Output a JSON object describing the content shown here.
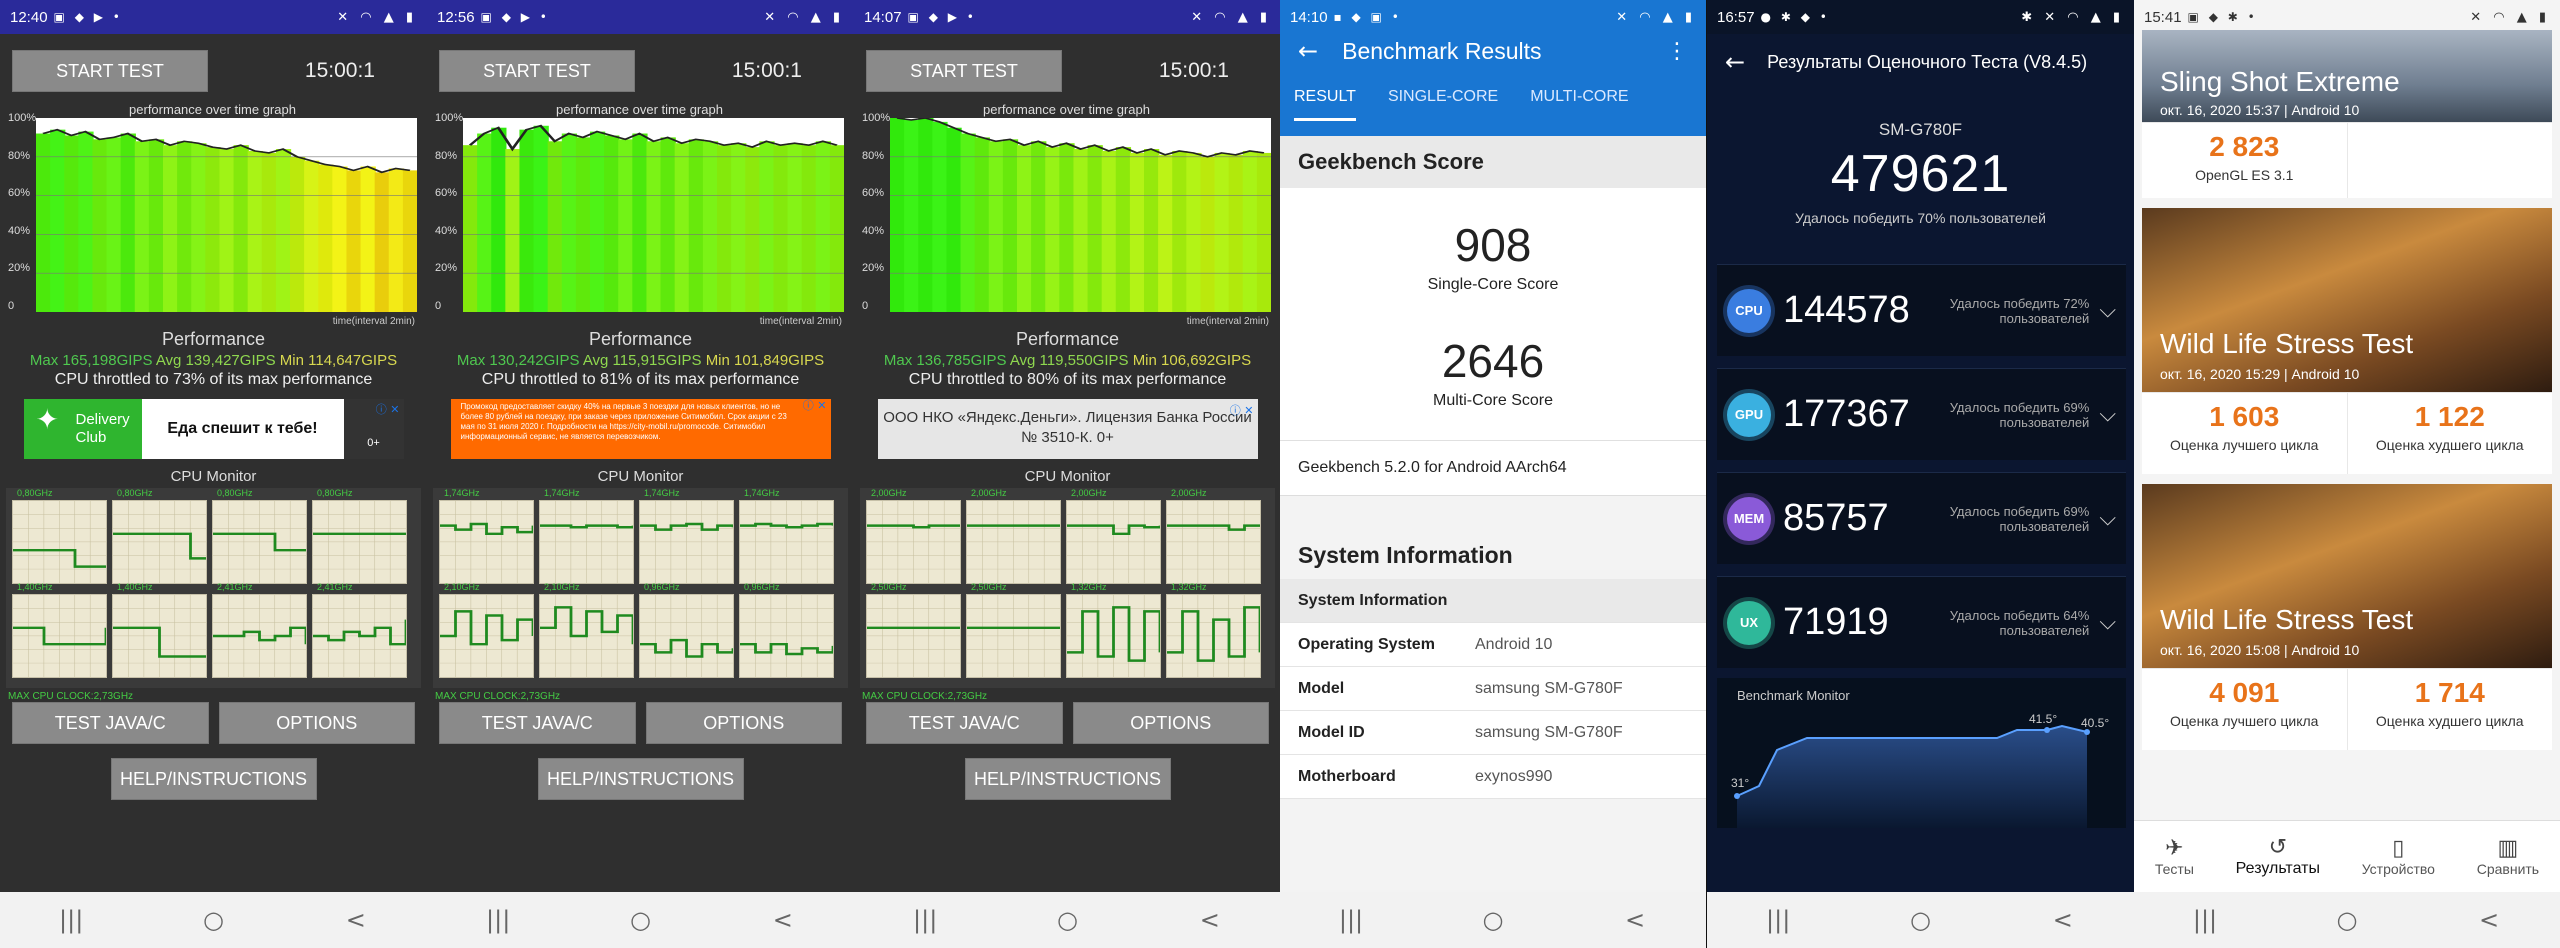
{
  "cpu_throttle": {
    "start_label": "START TEST",
    "timer": "15:00:1",
    "graph_title": "performance over time graph",
    "y_ticks": [
      "100%",
      "80%",
      "60%",
      "40%",
      "20%",
      "0"
    ],
    "x_axis_label": "time(interval 2min)",
    "perf_title": "Performance",
    "monitor_title": "CPU Monitor",
    "max_clock": "MAX CPU CLOCK:2,73GHz",
    "test_label": "TEST JAVA/C",
    "options_label": "OPTIONS",
    "help_label": "HELP/INSTRUCTIONS",
    "screens": [
      {
        "time": "12:40",
        "max": "Max 165,198GIPS",
        "avg": "Avg 139,427GIPS",
        "min": "Min 114,647GIPS",
        "throttle": "CPU throttled to 73% of its max performance",
        "freqs": [
          "0,80GHz",
          "0,80GHz",
          "0,80GHz",
          "0,80GHz",
          "1,40GHz",
          "1,40GHz",
          "2,41GHz",
          "2,41GHz"
        ],
        "perf": [
          92,
          94,
          91,
          93,
          89,
          90,
          92,
          88,
          89,
          86,
          88,
          87,
          85,
          84,
          86,
          83,
          82,
          84,
          80,
          78,
          76,
          75,
          73,
          75,
          72,
          74,
          73
        ],
        "ad": {
          "brand": "Delivery Club",
          "text": "Еда спешит к тебе!"
        }
      },
      {
        "time": "12:56",
        "max": "Max 130,242GIPS",
        "avg": "Avg 115,915GIPS",
        "min": "Min 101,849GIPS",
        "throttle": "CPU throttled to 81% of its max performance",
        "freqs": [
          "1,74GHz",
          "1,74GHz",
          "1,74GHz",
          "1,74GHz",
          "2,10GHz",
          "2,10GHz",
          "0,96GHz",
          "0,96GHz"
        ],
        "perf": [
          86,
          92,
          95,
          84,
          94,
          96,
          88,
          92,
          90,
          93,
          91,
          89,
          92,
          88,
          90,
          87,
          89,
          88,
          86,
          87,
          85,
          88,
          86,
          87,
          86,
          88,
          86
        ],
        "ad": {
          "text": "Промокод предоставляет скидку 40% на первые 3 поездки для новых клиентов, но не более 80 рублей на поездку, при заказе через приложение Ситимобил. Срок акции с 23 мая по 31 июля 2020 г. Подробности на https://city-mobil.ru/promocode. Ситимобил информационный сервис, не является перевозчиком."
        }
      },
      {
        "time": "14:07",
        "max": "Max 136,785GIPS",
        "avg": "Avg 119,550GIPS",
        "min": "Min 106,692GIPS",
        "throttle": "CPU throttled to 80% of its max performance",
        "freqs": [
          "2,00GHz",
          "2,00GHz",
          "2,00GHz",
          "2,00GHz",
          "2,50GHz",
          "2,50GHz",
          "1,32GHz",
          "1,32GHz"
        ],
        "perf": [
          100,
          99,
          100,
          98,
          95,
          92,
          90,
          88,
          89,
          86,
          88,
          85,
          87,
          84,
          86,
          83,
          85,
          82,
          84,
          81,
          83,
          82,
          80,
          82,
          81,
          83,
          82
        ],
        "ad": {
          "text": "ООО НКО «Яндекс.Деньги». Лицензия Банка России № 3510-К. 0+"
        }
      }
    ]
  },
  "geekbench": {
    "time": "14:10",
    "title": "Benchmark Results",
    "tabs": [
      "RESULT",
      "SINGLE-CORE",
      "MULTI-CORE"
    ],
    "score_header": "Geekbench Score",
    "single_score": "908",
    "single_label": "Single-Core Score",
    "multi_score": "2646",
    "multi_label": "Multi-Core Score",
    "version": "Geekbench 5.2.0 for Android AArch64",
    "sys_title": "System Information",
    "sys_header": "System Information",
    "rows": [
      {
        "k": "Operating System",
        "v": "Android 10"
      },
      {
        "k": "Model",
        "v": "samsung SM-G780F"
      },
      {
        "k": "Model ID",
        "v": "samsung SM-G780F"
      },
      {
        "k": "Motherboard",
        "v": "exynos990"
      }
    ]
  },
  "antutu": {
    "time": "16:57",
    "title": "Результаты Оценочного Теста (V8.4.5)",
    "device": "SM-G780F",
    "total": "479621",
    "beat": "Удалось победить 70% пользователей",
    "rows": [
      {
        "badge": "CPU",
        "value": "144578",
        "beat": "Удалось победить 72% пользователей",
        "color": "#3a7de0"
      },
      {
        "badge": "GPU",
        "value": "177367",
        "beat": "Удалось победить 69% пользователей",
        "color": "#3ab0e0"
      },
      {
        "badge": "MEM",
        "value": "85757",
        "beat": "Удалось победить 69% пользователей",
        "color": "#8a5ad8"
      },
      {
        "badge": "UX",
        "value": "71919",
        "beat": "Удалось победить 64% пользователей",
        "color": "#2fb89a"
      }
    ],
    "monitor_title": "Benchmark Monitor",
    "temp_start": "31°",
    "temp_peak": "41.5°",
    "temp_end": "40.5°"
  },
  "threedmark": {
    "time": "15:41",
    "tests": [
      {
        "name": "Sling Shot Extreme",
        "date": "окт. 16, 2020 15:37 | Android 10",
        "scores": [
          {
            "value": "2 823",
            "label": "OpenGL ES 3.1"
          }
        ]
      },
      {
        "name": "Wild Life Stress Test",
        "date": "окт. 16, 2020 15:29 | Android 10",
        "scores": [
          {
            "value": "1 603",
            "label": "Оценка лучшего цикла"
          },
          {
            "value": "1 122",
            "label": "Оценка худшего цикла"
          }
        ]
      },
      {
        "name": "Wild Life Stress Test",
        "date": "окт. 16, 2020 15:08 | Android 10",
        "scores": [
          {
            "value": "4 091",
            "label": "Оценка лучшего цикла"
          },
          {
            "value": "1 714",
            "label": "Оценка худшего цикла"
          }
        ]
      }
    ],
    "nav": [
      {
        "icon": "tests-icon",
        "label": "Тесты"
      },
      {
        "icon": "results-icon",
        "label": "Результаты"
      },
      {
        "icon": "device-icon",
        "label": "Устройство"
      },
      {
        "icon": "compare-icon",
        "label": "Сравнить"
      }
    ]
  },
  "system_nav": {
    "recents": "|||",
    "home": "○",
    "back": "<"
  }
}
